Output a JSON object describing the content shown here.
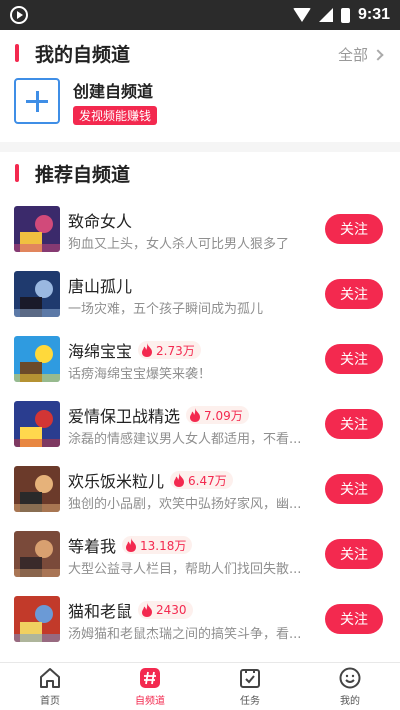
{
  "status_bar": {
    "time": "9:31"
  },
  "my_channels": {
    "title": "我的自频道",
    "more_label": "全部",
    "create": {
      "title": "创建自频道",
      "badge": "发视频能赚钱"
    }
  },
  "recommended": {
    "title": "推荐自频道",
    "follow_label": "关注",
    "items": [
      {
        "title": "致命女人",
        "hot": "",
        "desc": "狗血又上头，女人杀人可比男人狠多了"
      },
      {
        "title": "唐山孤儿",
        "hot": "",
        "desc": "一场灾难，五个孩子瞬间成为孤儿"
      },
      {
        "title": "海绵宝宝",
        "hot": "2.73万",
        "desc": "话痨海绵宝宝爆笑来袭！"
      },
      {
        "title": "爱情保卫战精选",
        "hot": "7.09万",
        "desc": "涂磊的情感建议男人女人都适用，不看..."
      },
      {
        "title": "欢乐饭米粒儿",
        "hot": "6.47万",
        "desc": "独创的小品剧，欢笑中弘扬好家风，幽..."
      },
      {
        "title": "等着我",
        "hot": "13.18万",
        "desc": "大型公益寻人栏目，帮助人们找回失散..."
      },
      {
        "title": "猫和老鼠",
        "hot": "2430",
        "desc": "汤姆猫和老鼠杰瑞之间的搞笑斗争，看..."
      }
    ]
  },
  "bottom_nav": [
    {
      "label": "首页",
      "icon": "home-icon",
      "active": false
    },
    {
      "label": "自频道",
      "icon": "channel-icon",
      "active": true
    },
    {
      "label": "任务",
      "icon": "task-icon",
      "active": false
    },
    {
      "label": "我的",
      "icon": "smile-icon",
      "active": false
    }
  ],
  "colors": {
    "accent": "#f3294f",
    "create_blue": "#3f8ee6",
    "desc_gray": "#8f8f8f"
  }
}
